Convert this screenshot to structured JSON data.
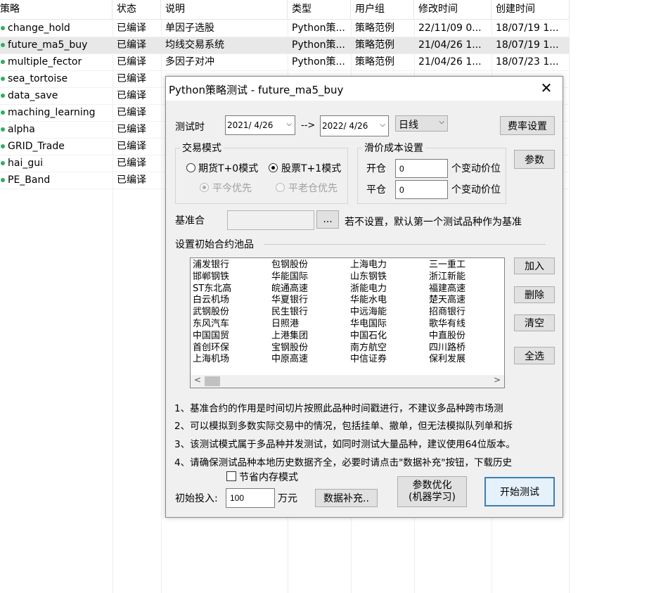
{
  "list": {
    "columns": [
      "策略",
      "状态",
      "说明",
      "类型",
      "用户组",
      "修改时间",
      "创建时间"
    ],
    "rows": [
      {
        "name": "change_hold",
        "status": "已编译",
        "desc": "单因子选股",
        "type": "Python策...",
        "group": "策略范例",
        "modified": "22/11/09 0...",
        "created": "18/07/19 1..."
      },
      {
        "name": "future_ma5_buy",
        "status": "已编译",
        "desc": "均线交易系统",
        "type": "Python策...",
        "group": "策略范例",
        "modified": "21/04/26 1...",
        "created": "18/07/19 1..."
      },
      {
        "name": "multiple_fector",
        "status": "已编译",
        "desc": "多因子对冲",
        "type": "Python策...",
        "group": "策略范例",
        "modified": "21/04/26 1...",
        "created": "18/07/23 1..."
      },
      {
        "name": "sea_tortoise",
        "status": "已编译",
        "desc": "",
        "type": "",
        "group": "",
        "modified": "",
        "created": ""
      },
      {
        "name": "data_save",
        "status": "已编译",
        "desc": "",
        "type": "",
        "group": "",
        "modified": "",
        "created": ""
      },
      {
        "name": "maching_learning",
        "status": "已编译",
        "desc": "",
        "type": "",
        "group": "",
        "modified": "",
        "created": ""
      },
      {
        "name": "alpha",
        "status": "已编译",
        "desc": "",
        "type": "",
        "group": "",
        "modified": "",
        "created": ""
      },
      {
        "name": "GRID_Trade",
        "status": "已编译",
        "desc": "",
        "type": "",
        "group": "",
        "modified": "",
        "created": ""
      },
      {
        "name": "hai_gui",
        "status": "已编译",
        "desc": "",
        "type": "",
        "group": "",
        "modified": "",
        "created": ""
      },
      {
        "name": "PE_Band",
        "status": "已编译",
        "desc": "",
        "type": "",
        "group": "",
        "modified": "",
        "created": ""
      }
    ]
  },
  "dialog": {
    "title": "Python策略测试 - future_ma5_buy",
    "close": "✕",
    "test_time_label": "测试时",
    "start_date": "2021/  4/26",
    "arrow": "-->",
    "end_date": "2022/  4/26",
    "period": "日线",
    "fee_button": "费率设置",
    "param_button": "参数",
    "trade_mode": {
      "label": "交易模式",
      "futures": "期货T+0模式",
      "stock": "股票T+1模式",
      "close_today": "平今优先",
      "close_old": "平老仓优先"
    },
    "slippage": {
      "label": "滑价成本设置",
      "open_label": "开仓",
      "open_value": "0",
      "close_label": "平仓",
      "close_value": "0",
      "unit": "个变动价位"
    },
    "benchmark_label": "基准合",
    "browse_button": "...",
    "benchmark_hint": "若不设置，默认第一个测试品种作为基准",
    "pool_label": "设置初始合约池品",
    "pool_columns": [
      [
        "浦发银行",
        "邯郸钢铁",
        "ST东北高",
        "白云机场",
        "武钢股份",
        "东风汽车",
        "中国国贸",
        "首创环保",
        "上海机场"
      ],
      [
        "包钢股份",
        "华能国际",
        "皖通高速",
        "华夏银行",
        "民生银行",
        "日照港",
        "上港集团",
        "宝钢股份",
        "中原高速"
      ],
      [
        "上海电力",
        "山东钢铁",
        "浙能电力",
        "华能水电",
        "中远海能",
        "华电国际",
        "中国石化",
        "南方航空",
        "中信证券"
      ],
      [
        "三一重工",
        "浙江新能",
        "福建高速",
        "楚天高速",
        "招商银行",
        "歌华有线",
        "中直股份",
        "四川路桥",
        "保利发展"
      ]
    ],
    "scroll_left": "<",
    "scroll_right": ">",
    "add_button": "加入",
    "delete_button": "删除",
    "clear_button": "清空",
    "select_all_button": "全选",
    "notes": [
      "1、基准合约的作用是时间切片按照此品种时间戳进行，不建议多品种跨市场测",
      "2、可以模拟到多数实际交易中的情况，包括挂单、撤单，但无法模拟队列单和拆",
      "3、该测试模式属于多品种并发测试，如同时测试大量品种，建议使用64位版本。",
      "4、请确保测试品种本地历史数据齐全，必要时请点击\"数据补充\"按钮，下载历史"
    ],
    "memory_mode": "节省内存模式",
    "initial_label": "初始投入:",
    "initial_value": "100",
    "initial_unit": "万元",
    "data_button": "数据补充..",
    "optimize_line1": "参数优化",
    "optimize_line2": "(机器学习)",
    "start_button": "开始测试"
  }
}
